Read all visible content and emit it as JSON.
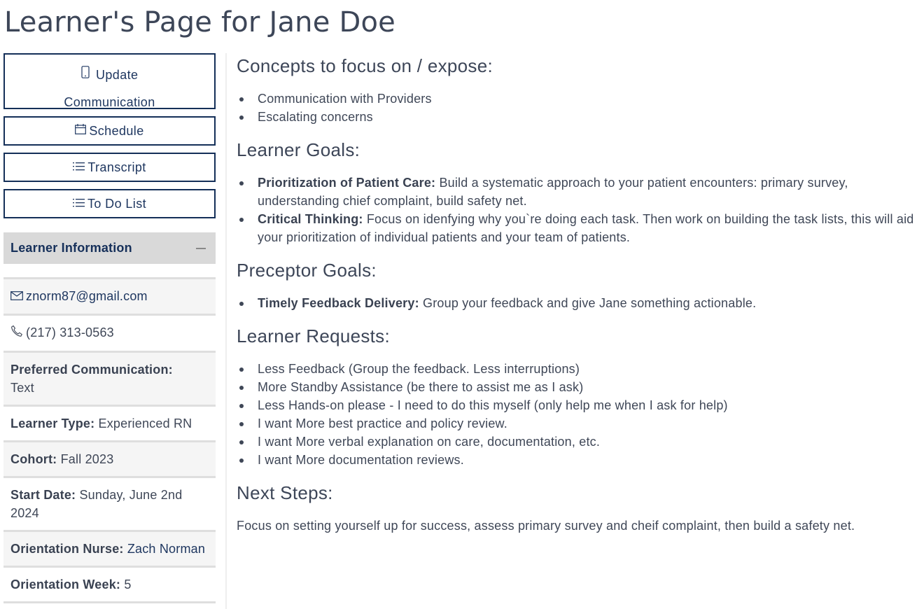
{
  "page": {
    "title": "Learner's Page for Jane Doe"
  },
  "sidebar": {
    "buttons": {
      "update_communication": {
        "label_line1": "Update",
        "label_line2": "Communication",
        "icon": "phone-device-icon"
      },
      "schedule": {
        "label": "Schedule",
        "icon": "calendar-icon"
      },
      "transcript": {
        "label": "Transcript",
        "icon": "list-icon"
      },
      "todo": {
        "label": "To Do List",
        "icon": "list-icon"
      }
    },
    "learner_info": {
      "title": "Learner Information",
      "toggle_icon": "minus-icon",
      "email": "znorm87@gmail.com",
      "phone": "(217) 313-0563",
      "fields": [
        {
          "label": "Preferred Communication:",
          "value": "Text"
        },
        {
          "label": "Learner Type:",
          "value": "Experienced RN"
        },
        {
          "label": "Cohort:",
          "value": "Fall 2023"
        },
        {
          "label": "Start Date:",
          "value": "Sunday, June 2nd 2024"
        },
        {
          "label": "Orientation Nurse:",
          "value": "Zach Norman"
        },
        {
          "label": "Orientation Week:",
          "value": "5"
        }
      ]
    }
  },
  "main": {
    "concepts": {
      "heading": "Concepts to focus on / expose:",
      "items": [
        "Communication with Providers",
        "Escalating concerns"
      ]
    },
    "learner_goals": {
      "heading": "Learner Goals:",
      "items": [
        {
          "title": "Prioritization of Patient Care:",
          "text": "Build a systematic approach to your patient encounters: primary survey, understanding chief complaint, build safety net."
        },
        {
          "title": "Critical Thinking:",
          "text": "Focus on idenfying why you`re doing each task. Then work on building the task lists, this will aid your prioritization of individual patients and your team of patients."
        }
      ]
    },
    "preceptor_goals": {
      "heading": "Preceptor Goals:",
      "items": [
        {
          "title": "Timely Feedback Delivery:",
          "text": "Group your feedback and give Jane something actionable."
        }
      ]
    },
    "learner_requests": {
      "heading": "Learner Requests:",
      "items": [
        "Less Feedback (Group the feedback. Less interruptions)",
        "More Standby Assistance (be there to assist me as I ask)",
        "Less Hands-on please - I need to do this myself (only help me when I ask for help)",
        "I want More best practice and policy review.",
        "I want More verbal explanation on care, documentation, etc.",
        "I want More documentation reviews."
      ]
    },
    "next_steps": {
      "heading": "Next Steps:",
      "text": "Focus on setting yourself up for success, assess primary survey and cheif complaint, then build a safety net."
    }
  }
}
